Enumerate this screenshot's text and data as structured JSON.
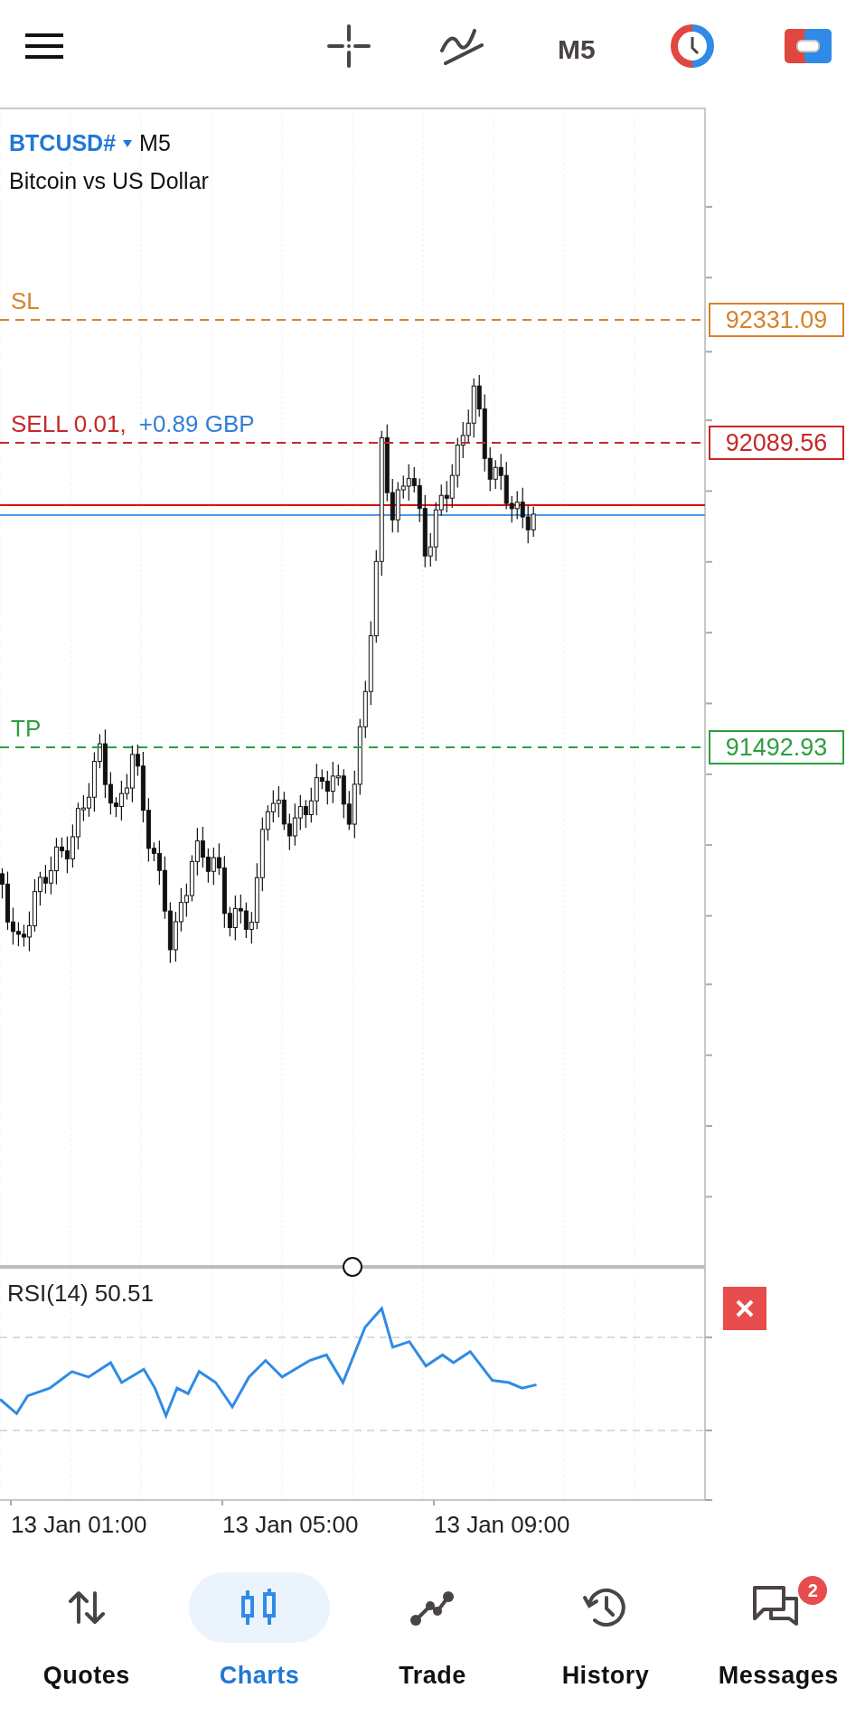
{
  "top_bar": {
    "timeframe": "M5"
  },
  "chart": {
    "symbol": "BTCUSD#",
    "timeframe": "M5",
    "description": "Bitcoin vs US Dollar",
    "levels": [
      {
        "kind": "sl",
        "label": "SL",
        "price": "92331.09",
        "color": "#d9822b"
      },
      {
        "kind": "order",
        "label": "SELL 0.01,",
        "profit": "+0.89 GBP",
        "price": "92089.56",
        "color": "#c62828"
      },
      {
        "kind": "tp",
        "label": "TP",
        "price": "91492.93",
        "color": "#2e9e3e"
      }
    ]
  },
  "indicator": {
    "label": "RSI(14) 50.51"
  },
  "time_axis": [
    "13 Jan 01:00",
    "13 Jan 05:00",
    "13 Jan 09:00"
  ],
  "nav": [
    {
      "label": "Quotes",
      "selected": false
    },
    {
      "label": "Charts",
      "selected": true
    },
    {
      "label": "Trade",
      "selected": false
    },
    {
      "label": "History",
      "selected": false
    },
    {
      "label": "Messages",
      "selected": false,
      "badge": "2"
    }
  ]
}
